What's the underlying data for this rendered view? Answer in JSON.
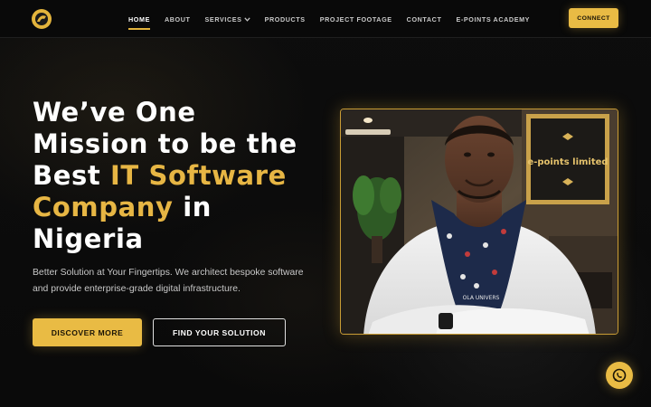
{
  "nav": {
    "links": [
      {
        "label": "HOME",
        "active": true
      },
      {
        "label": "ABOUT"
      },
      {
        "label": "SERVICES"
      },
      {
        "label": "PRODUCTS"
      },
      {
        "label": "PROJECT FOOTAGE"
      },
      {
        "label": "CONTACT"
      },
      {
        "label": "E-POINTS ACADEMY"
      }
    ],
    "connect_label": "CONNECT"
  },
  "hero": {
    "headline_line1": "We’ve One",
    "headline_line2": "Mission to be the",
    "headline_best": "Best ",
    "headline_gold1": "IT Software",
    "headline_gold2": "Company",
    "headline_in": " in",
    "headline_line5": "Nigeria",
    "subtext": "Better Solution at Your Fingertips. We architect bespoke software and provide enterprise-grade digital infrastructure.",
    "discover_label": "DISCOVER MORE",
    "find_label": "FIND YOUR SOLUTION"
  },
  "photo": {
    "sign_text": "e-points limited",
    "scarf_text": "OLA UNIVERS"
  },
  "colors": {
    "accent": "#e9bb44",
    "background": "#0b0b0b"
  },
  "icons": {
    "logo": "logo-icon",
    "services_dropdown": "chevron-down-icon",
    "whatsapp": "whatsapp-icon"
  }
}
